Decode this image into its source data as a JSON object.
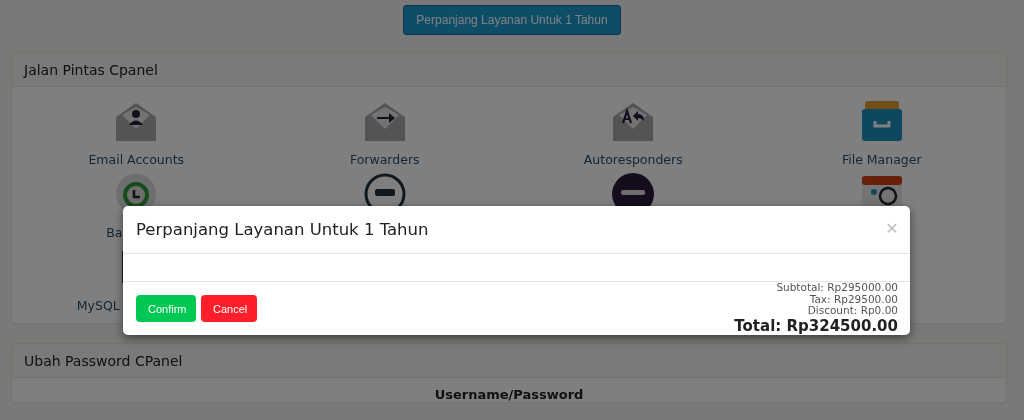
{
  "renew_button": "Perpanjang Layanan Untuk 1 Tahun",
  "shortcuts": {
    "title": "Jalan Pintas Cpanel",
    "items": [
      {
        "label": "Email Accounts"
      },
      {
        "label": "Forwarders"
      },
      {
        "label": "Autoresponders"
      },
      {
        "label": "File Manager"
      },
      {
        "label": "Ba"
      },
      {
        "label": "MySQL"
      }
    ]
  },
  "password": {
    "title": "Ubah Password CPanel",
    "heading": "Username/Password"
  },
  "modal": {
    "title": "Perpanjang Layanan Untuk 1 Tahun",
    "close": "×",
    "buttons": [
      {
        "label": "Confirm",
        "kind": "confirm"
      },
      {
        "label": "Cancel",
        "kind": "cancel"
      }
    ],
    "subtotal": "Subtotal: Rp295000.00",
    "tax": "Tax: Rp29500.00",
    "discount": "Discount: Rp0.00",
    "total": "Total: Rp324500.00"
  }
}
